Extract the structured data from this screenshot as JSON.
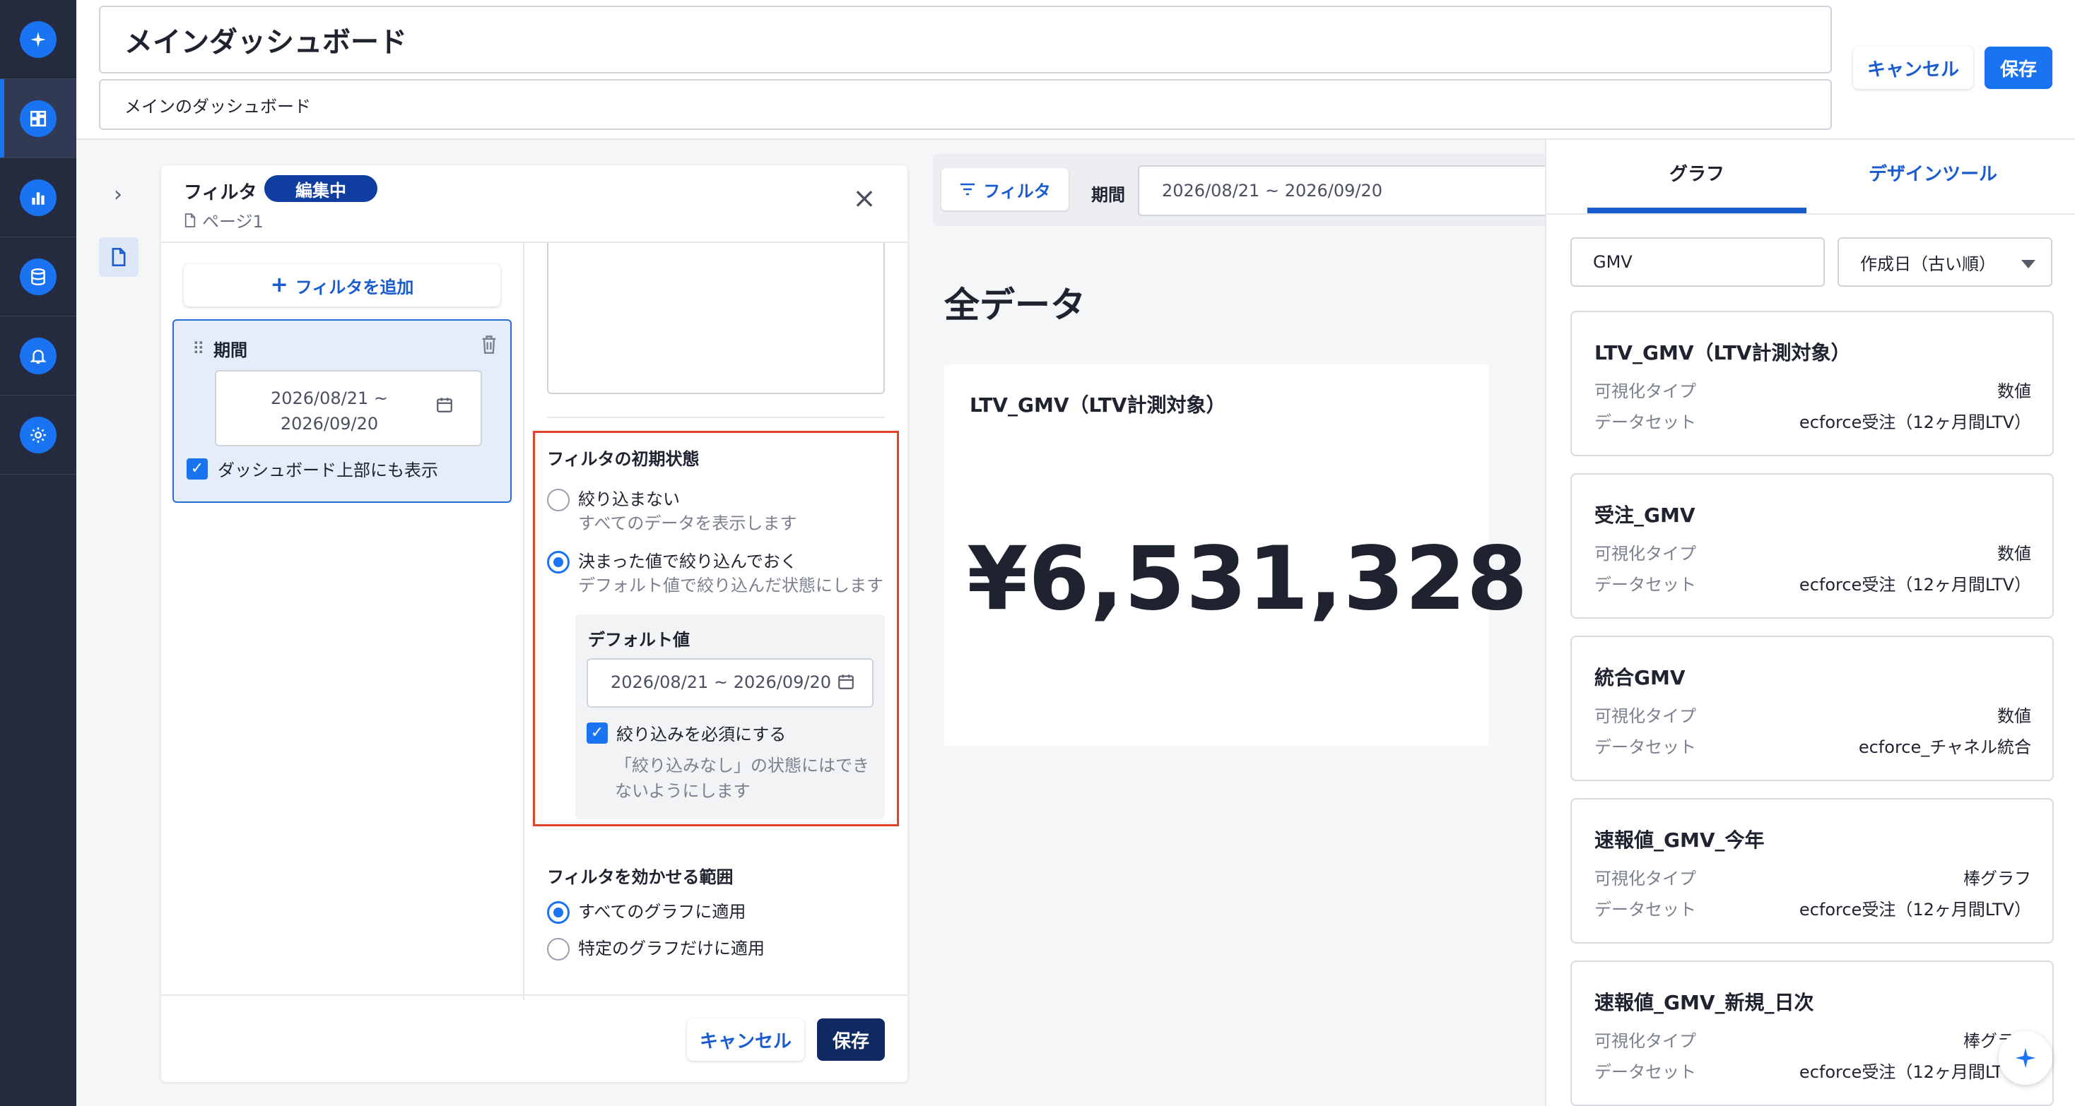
{
  "header": {
    "title": "メインダッシュボード",
    "description": "メインのダッシュボード",
    "cancel_label": "キャンセル",
    "save_label": "保存"
  },
  "filter_panel": {
    "title": "フィルタ",
    "status_badge": "編集中",
    "page_label": "ページ1",
    "add_filter_label": "フィルタを追加",
    "filter_item": {
      "label": "期間",
      "date_line1": "2026/08/21 ~",
      "date_line2": "2026/09/20",
      "show_on_top_label": "ダッシュボード上部にも表示"
    },
    "initial_state": {
      "title": "フィルタの初期状態",
      "option_none_label": "絞り込まない",
      "option_none_help": "すべてのデータを表示します",
      "option_fixed_label": "決まった値で絞り込んでおく",
      "option_fixed_help": "デフォルト値で絞り込んだ状態にします",
      "default_value_label": "デフォルト値",
      "default_value": "2026/08/21 ~ 2026/09/20",
      "required_label": "絞り込みを必須にする",
      "required_help": "「絞り込みなし」の状態にはできないようにします"
    },
    "scope": {
      "title": "フィルタを効かせる範囲",
      "option_all": "すべてのグラフに適用",
      "option_specific": "特定のグラフだけに適用"
    },
    "cancel_label": "キャンセル",
    "save_label": "保存"
  },
  "dashboard": {
    "filter_button_label": "フィルタ",
    "period_label": "期間",
    "period_value": "2026/08/21 ~ 2026/09/20",
    "section_title": "全データ",
    "kpi": {
      "title": "LTV_GMV（LTV計測対象）",
      "value": "¥6,531,328"
    }
  },
  "right_panel": {
    "tabs": [
      {
        "label": "グラフ",
        "active": true
      },
      {
        "label": "デザインツール",
        "active": false
      }
    ],
    "search_value": "GMV",
    "sort_value": "作成日（古い順）",
    "key_type": "可視化タイプ",
    "key_dataset": "データセット",
    "graphs": [
      {
        "name": "LTV_GMV（LTV計測対象）",
        "type": "数値",
        "dataset": "ecforce受注（12ヶ月間LTV）"
      },
      {
        "name": "受注_GMV",
        "type": "数値",
        "dataset": "ecforce受注（12ヶ月間LTV）"
      },
      {
        "name": "統合GMV",
        "type": "数値",
        "dataset": "ecforce_チャネル統合"
      },
      {
        "name": "速報値_GMV_今年",
        "type": "棒グラフ",
        "dataset": "ecforce受注（12ヶ月間LTV）"
      },
      {
        "name": "速報値_GMV_新規_日次",
        "type": "棒グラフ",
        "dataset": "ecforce受注（12ヶ月間LTV）"
      }
    ]
  },
  "colors": {
    "accent": "#1a73f0",
    "rail": "#252b3f",
    "highlight_border": "#e0442c",
    "badge": "#0f3da0"
  },
  "icons": {
    "rail": [
      "sparkle-icon",
      "dashboard-grid-icon",
      "bar-chart-icon",
      "database-icon",
      "bell-icon",
      "gear-icon"
    ]
  }
}
